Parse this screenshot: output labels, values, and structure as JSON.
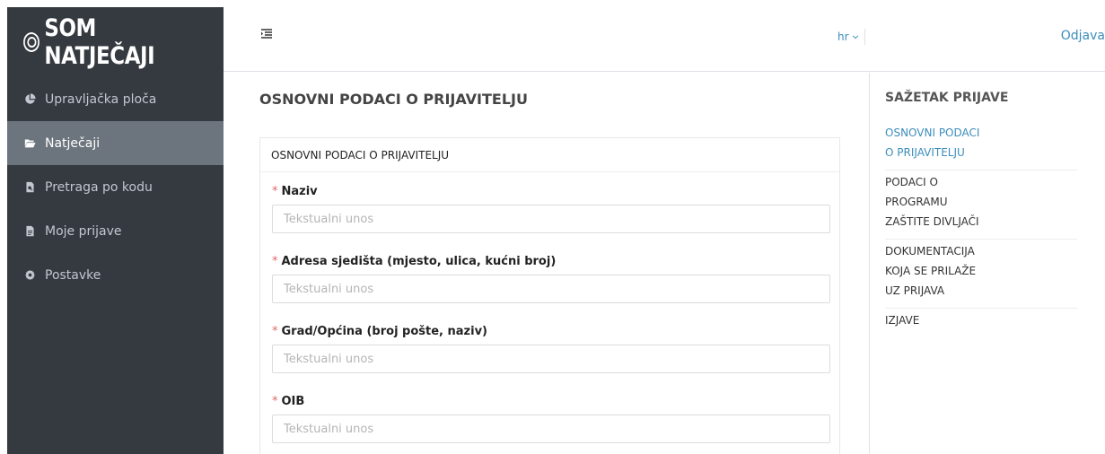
{
  "app": {
    "logo_text": "SOM NATJEČAJI"
  },
  "sidebar": {
    "items": [
      {
        "label": "Upravljačka ploča",
        "icon": "pie-chart-icon",
        "active": false
      },
      {
        "label": "Natječaji",
        "icon": "folder-open-icon",
        "active": true
      },
      {
        "label": "Pretraga po kodu",
        "icon": "file-search-icon",
        "active": false
      },
      {
        "label": "Moje prijave",
        "icon": "file-text-icon",
        "active": false
      },
      {
        "label": "Postavke",
        "icon": "gear-icon",
        "active": false
      }
    ]
  },
  "header": {
    "menu_toggle_icon": "menu-collapse-icon",
    "language": "hr",
    "language_caret_icon": "chevron-down-icon",
    "logout_label": "Odjava"
  },
  "main": {
    "page_title": "OSNOVNI PODACI O PRIJAVITELJU",
    "card": {
      "header": "OSNOVNI PODACI O PRIJAVITELJU",
      "fields": [
        {
          "label": "Naziv",
          "required_mark": "*",
          "placeholder": "Tekstualni unos",
          "value": ""
        },
        {
          "label": "Adresa sjedišta (mjesto, ulica, kućni broj)",
          "required_mark": "*",
          "placeholder": "Tekstualni unos",
          "value": ""
        },
        {
          "label": "Grad/Općina (broj pošte, naziv)",
          "required_mark": "*",
          "placeholder": "Tekstualni unos",
          "value": ""
        },
        {
          "label": "OIB",
          "required_mark": "*",
          "placeholder": "Tekstualni unos",
          "value": ""
        }
      ]
    }
  },
  "summary": {
    "title": "SAŽETAK PRIJAVE",
    "items": [
      {
        "lines": [
          "OSNOVNI PODACI",
          "O PRIJAVITELJU"
        ],
        "active": true
      },
      {
        "lines": [
          "PODACI O",
          "PROGRAMU",
          "ZAŠTITE DIVLJAČI"
        ],
        "active": false
      },
      {
        "lines": [
          "DOKUMENTACIJA",
          "KOJA SE PRILAŽE",
          "UZ PRIJAVA"
        ],
        "active": false
      },
      {
        "lines": [
          "IZJAVE"
        ],
        "active": false
      }
    ]
  },
  "colors": {
    "sidebar_bg": "#343a40",
    "sidebar_active_bg": "#6c757d",
    "link_blue": "#3c8dbc",
    "required_red": "#e06666"
  }
}
